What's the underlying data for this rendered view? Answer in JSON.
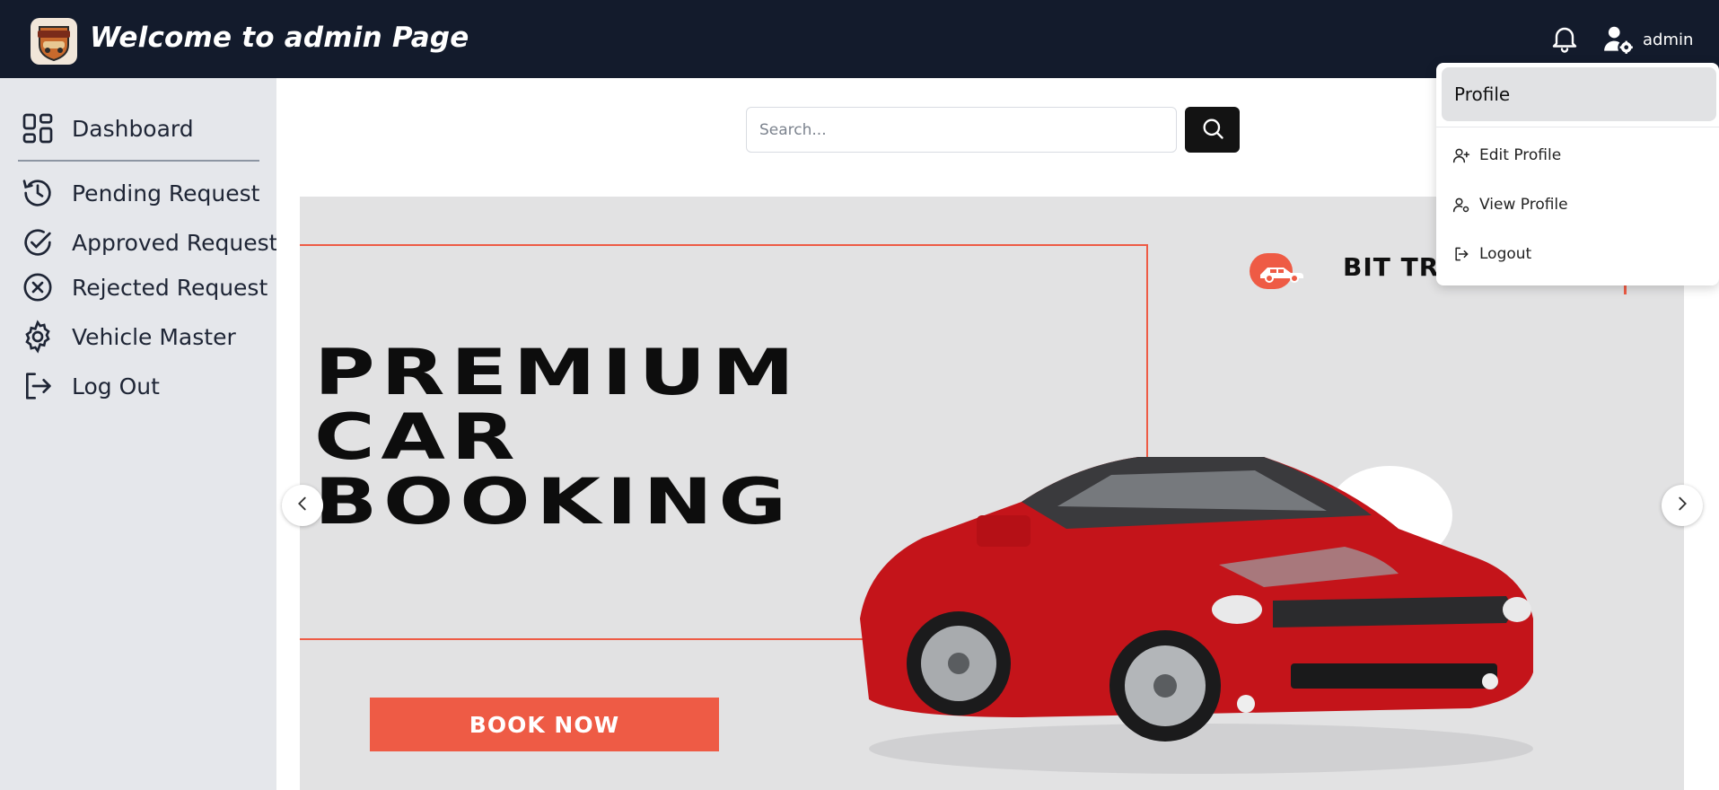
{
  "header": {
    "title": "Welcome to admin Page",
    "user_name": "admin",
    "background_color": "#131b2c"
  },
  "sidebar": {
    "items": [
      {
        "label": "Dashboard",
        "icon": "dashboard-icon"
      },
      {
        "label": "Pending Request",
        "icon": "history-icon"
      },
      {
        "label": "Approved Request",
        "icon": "check-circle-icon"
      },
      {
        "label": "Rejected Request",
        "icon": "x-circle-icon"
      },
      {
        "label": "Vehicle Master",
        "icon": "gear-icon"
      },
      {
        "label": "Log Out",
        "icon": "logout-icon"
      }
    ]
  },
  "search": {
    "placeholder": "Search...",
    "value": ""
  },
  "banner": {
    "headline": [
      "PREMIUM",
      "CAR",
      "BOOKING"
    ],
    "brand": "BIT TRA",
    "cta": "BOOK NOW",
    "accent_color": "#ee5b45"
  },
  "profile_menu": {
    "header": "Profile",
    "items": [
      {
        "label": "Edit Profile",
        "icon": "user-plus-icon"
      },
      {
        "label": "View Profile",
        "icon": "user-gear-icon"
      },
      {
        "label": "Logout",
        "icon": "logout-icon"
      }
    ]
  }
}
